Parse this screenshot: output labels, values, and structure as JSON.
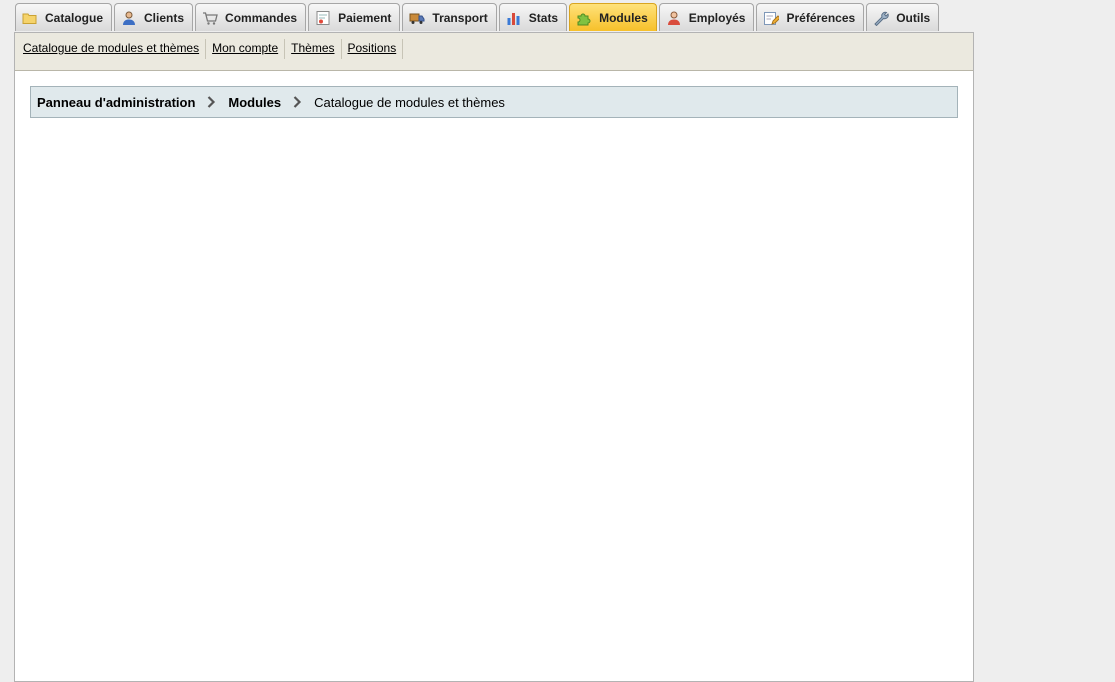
{
  "tabs": [
    {
      "label": "Catalogue",
      "icon": "folder-icon"
    },
    {
      "label": "Clients",
      "icon": "user-icon"
    },
    {
      "label": "Commandes",
      "icon": "cart-icon"
    },
    {
      "label": "Paiement",
      "icon": "invoice-icon"
    },
    {
      "label": "Transport",
      "icon": "truck-icon"
    },
    {
      "label": "Stats",
      "icon": "bar-chart-icon"
    },
    {
      "label": "Modules",
      "icon": "puzzle-icon",
      "active": true
    },
    {
      "label": "Employés",
      "icon": "employee-icon"
    },
    {
      "label": "Préférences",
      "icon": "preferences-icon"
    },
    {
      "label": "Outils",
      "icon": "wrench-icon"
    }
  ],
  "subnav": {
    "items": [
      "Catalogue de modules et thèmes",
      "Mon compte",
      "Thèmes",
      "Positions"
    ]
  },
  "breadcrumb": {
    "root": "Panneau d'administration",
    "section": "Modules",
    "current": "Catalogue de modules et thèmes"
  },
  "colors": {
    "active_tab": "#f6c02a",
    "subnav_bg": "#ebe9df",
    "breadcrumb_bg": "#e0e9ec"
  }
}
